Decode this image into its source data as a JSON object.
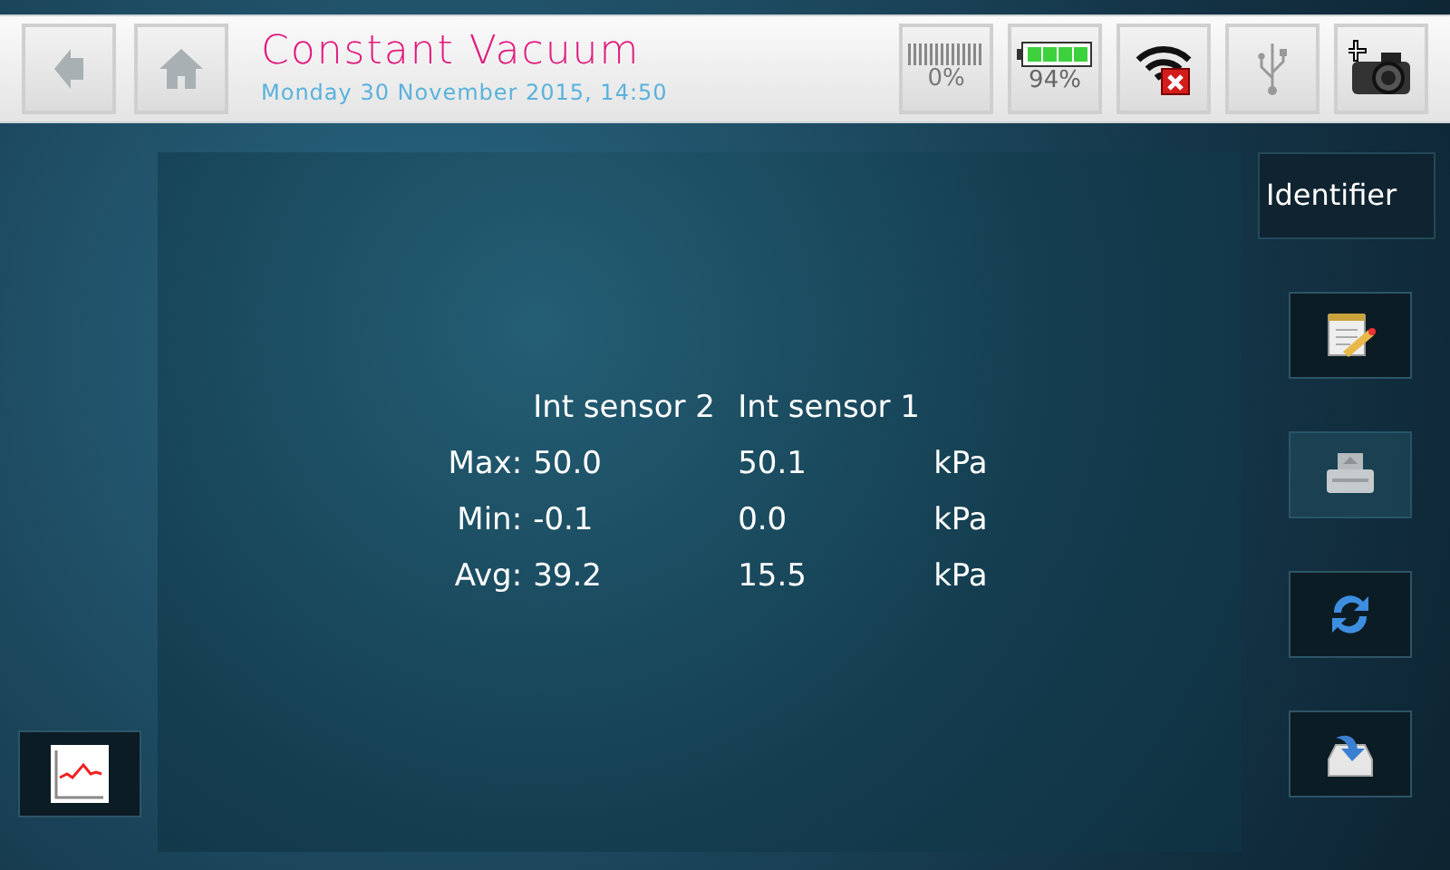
{
  "header": {
    "title": "Constant Vacuum",
    "datetime": "Monday 30 November 2015, 14:50",
    "storage": "0%",
    "battery": "94%"
  },
  "results": {
    "columns": [
      "Int sensor 2",
      "Int sensor 1"
    ],
    "rows": [
      {
        "label": "Max:",
        "values": [
          "50.0",
          "50.1"
        ],
        "unit": "kPa"
      },
      {
        "label": "Min:",
        "values": [
          "-0.1",
          "0.0"
        ],
        "unit": "kPa"
      },
      {
        "label": "Avg:",
        "values": [
          "39.2",
          "15.5"
        ],
        "unit": "kPa"
      }
    ]
  },
  "identifier_button": "Identifier",
  "side_buttons": [
    {
      "kind": "notepad",
      "disabled": false
    },
    {
      "kind": "print",
      "disabled": true
    },
    {
      "kind": "refresh",
      "disabled": false
    },
    {
      "kind": "save",
      "disabled": false
    }
  ]
}
